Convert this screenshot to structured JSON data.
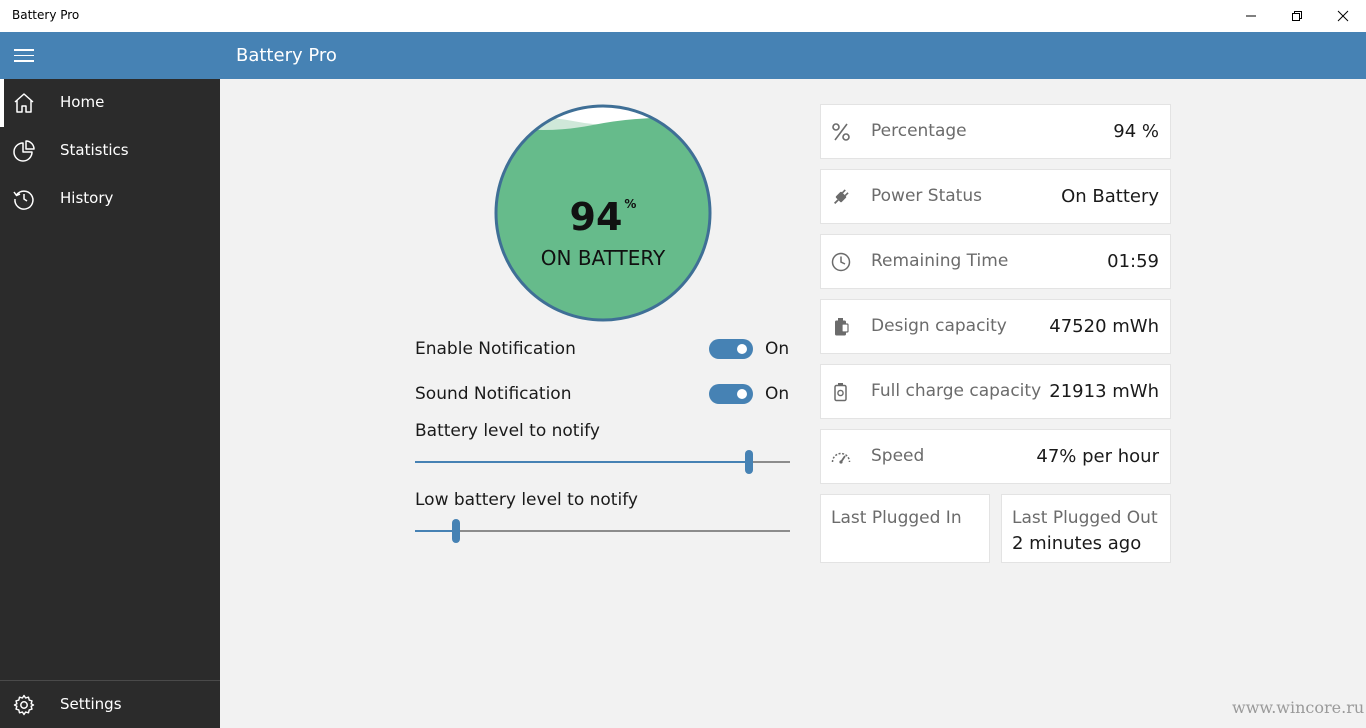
{
  "window": {
    "title": "Battery Pro",
    "controls": {
      "minimize_icon": "minimize-icon",
      "restore_icon": "restore-icon",
      "close_icon": "close-icon"
    }
  },
  "header": {
    "menu_icon": "hamburger-icon",
    "title": "Battery Pro",
    "color": "#4682b4"
  },
  "sidebar": {
    "items": [
      {
        "label": "Home",
        "icon": "home-icon",
        "active": true
      },
      {
        "label": "Statistics",
        "icon": "pie-chart-icon",
        "active": false
      },
      {
        "label": "History",
        "icon": "history-icon",
        "active": false
      }
    ],
    "footer": {
      "label": "Settings",
      "icon": "gear-icon"
    }
  },
  "gauge": {
    "percent": "94",
    "percent_sign": "%",
    "level": 0.94,
    "status": "ON BATTERY",
    "fill_color": "#66bb8b"
  },
  "options": {
    "enable_notification": {
      "label": "Enable Notification",
      "value": "On",
      "on": true
    },
    "sound_notification": {
      "label": "Sound Notification",
      "value": "On",
      "on": true
    }
  },
  "sliders": {
    "battery_level": {
      "label": "Battery level to notify",
      "fraction": 0.89
    },
    "low_battery_level": {
      "label": "Low battery level to notify",
      "fraction": 0.11
    }
  },
  "info": {
    "percentage": {
      "icon": "percent-icon",
      "label": "Percentage",
      "value": "94 %"
    },
    "power_status": {
      "icon": "plug-icon",
      "label": "Power Status",
      "value": "On Battery"
    },
    "remaining_time": {
      "icon": "clock-icon",
      "label": "Remaining Time",
      "value": "01:59"
    },
    "design_capacity": {
      "icon": "battery-icon",
      "label": "Design capacity",
      "value": "47520 mWh"
    },
    "full_charge_capacity": {
      "icon": "battery-full-icon",
      "label": "Full charge capacity",
      "value": "21913 mWh"
    },
    "speed": {
      "icon": "speedometer-icon",
      "label": "Speed",
      "value": "47% per hour"
    },
    "last_plugged_in": {
      "label": "Last Plugged In",
      "value": ""
    },
    "last_plugged_out": {
      "label": "Last Plugged Out",
      "value": "2 minutes ago"
    }
  },
  "watermark": "www.wincore.ru"
}
